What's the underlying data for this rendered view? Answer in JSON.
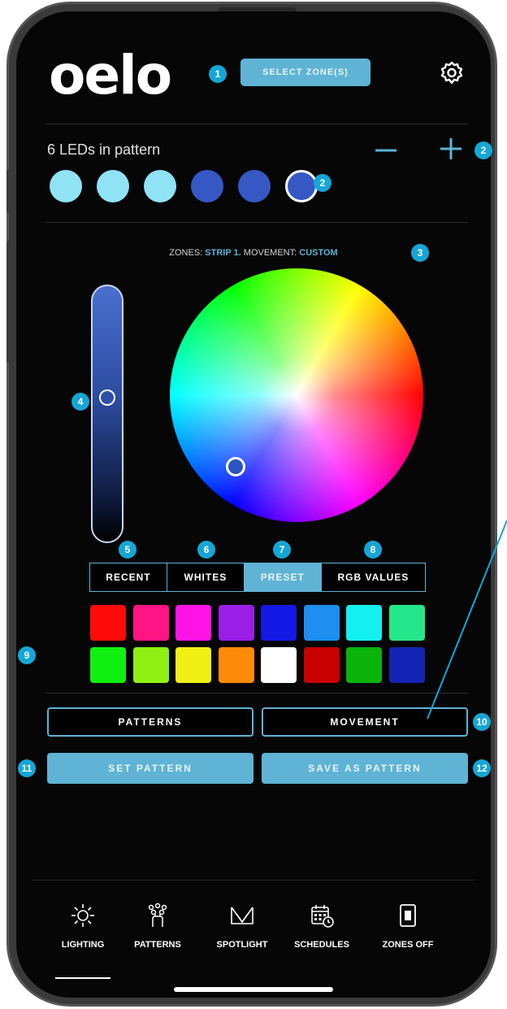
{
  "app": {
    "logo_text": "oelo"
  },
  "header": {
    "select_zone_label": "SELECT ZONE(S)",
    "settings_icon": "gear-icon"
  },
  "callouts": [
    "1",
    "2",
    "2",
    "3",
    "4",
    "5",
    "6",
    "7",
    "8",
    "9",
    "10",
    "11",
    "12"
  ],
  "pattern": {
    "led_count_label": "6 LEDs in pattern",
    "decrease_icon": "minus-icon",
    "increase_icon": "plus-icon",
    "leds": [
      {
        "color": "#8fe3f4"
      },
      {
        "color": "#8fe3f4"
      },
      {
        "color": "#8fe3f4"
      },
      {
        "color": "#3558c4"
      },
      {
        "color": "#3558c4"
      },
      {
        "color": "#3558c4",
        "selected": true
      }
    ]
  },
  "zone_info": {
    "zones_label": "ZONES:",
    "zone_name": "STRIP 1.",
    "movement_label": "MOVEMENT:",
    "movement_value": "CUSTOM"
  },
  "brightness": {
    "level": 0.55,
    "color": "#2d4fa8"
  },
  "color_wheel": {
    "selected_color": "#2a55c0"
  },
  "tabs": [
    {
      "label": "RECENT",
      "active": false
    },
    {
      "label": "WHITES",
      "active": false
    },
    {
      "label": "PRESET",
      "active": true
    },
    {
      "label": "RGB VALUES",
      "active": false
    }
  ],
  "swatches": [
    [
      "#ff0a0a",
      "#ff1483",
      "#ff14e6",
      "#9a1ee6",
      "#1418e6",
      "#1e8ef0",
      "#14f0f0",
      "#24e68a"
    ],
    [
      "#10f010",
      "#8ef014",
      "#f0f014",
      "#ff8a0a",
      "#ffffff",
      "#c80000",
      "#0ab40a",
      "#1424b4"
    ]
  ],
  "actions": {
    "patterns_label": "PATTERNS",
    "movement_label": "MOVEMENT",
    "set_pattern_label": "SET PATTERN",
    "save_as_pattern_label": "SAVE AS PATTERN"
  },
  "nav": [
    {
      "label": "LIGHTING",
      "icon": "sun-icon",
      "active": true
    },
    {
      "label": "PATTERNS",
      "icon": "pattern-icon",
      "active": false
    },
    {
      "label": "SPOTLIGHT",
      "icon": "spotlight-icon",
      "active": false
    },
    {
      "label": "SCHEDULES",
      "icon": "calendar-icon",
      "active": false
    },
    {
      "label": "ZONES OFF",
      "icon": "switch-icon",
      "active": false
    }
  ],
  "colors": {
    "accent": "#5fb3d4",
    "callout": "#16a6d6",
    "background": "#060606"
  }
}
